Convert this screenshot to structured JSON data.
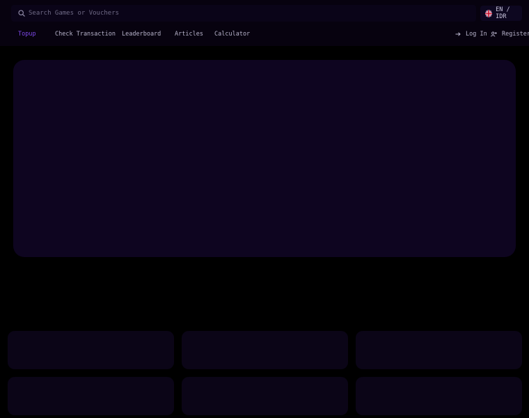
{
  "search": {
    "placeholder": "Search Games or Vouchers"
  },
  "locale": {
    "label": "EN / IDR",
    "flag_icon": "uk-flag-icon"
  },
  "nav": {
    "items": [
      {
        "label": "Topup",
        "active": true
      },
      {
        "label": "Check Transaction",
        "active": false
      },
      {
        "label": "Leaderboard",
        "active": false
      },
      {
        "label": "Articles",
        "active": false
      },
      {
        "label": "Calculator",
        "active": false
      }
    ]
  },
  "auth": {
    "login_label": "Log In",
    "register_label": "Register"
  },
  "colors": {
    "accent": "#7c47e6",
    "background": "#000000",
    "header": "#07020f",
    "banner": "#0e0520",
    "card": "#0b0517"
  }
}
